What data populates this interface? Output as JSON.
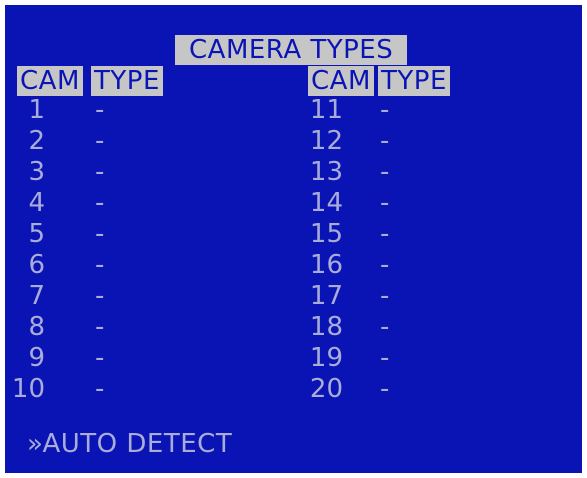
{
  "screen": {
    "title": "CAMERA TYPES",
    "headers": {
      "cam_left": "CAM",
      "type_left": "TYPE",
      "cam_right": "CAM",
      "type_right": "TYPE"
    },
    "left_rows": [
      {
        "cam": "1",
        "type": "-"
      },
      {
        "cam": "2",
        "type": "-"
      },
      {
        "cam": "3",
        "type": "-"
      },
      {
        "cam": "4",
        "type": "-"
      },
      {
        "cam": "5",
        "type": "-"
      },
      {
        "cam": "6",
        "type": "-"
      },
      {
        "cam": "7",
        "type": "-"
      },
      {
        "cam": "8",
        "type": "-"
      },
      {
        "cam": "9",
        "type": "-"
      },
      {
        "cam": "10",
        "type": "-"
      }
    ],
    "right_rows": [
      {
        "cam": "11",
        "type": "-"
      },
      {
        "cam": "12",
        "type": "-"
      },
      {
        "cam": "13",
        "type": "-"
      },
      {
        "cam": "14",
        "type": "-"
      },
      {
        "cam": "15",
        "type": "-"
      },
      {
        "cam": "16",
        "type": "-"
      },
      {
        "cam": "17",
        "type": "-"
      },
      {
        "cam": "18",
        "type": "-"
      },
      {
        "cam": "19",
        "type": "-"
      },
      {
        "cam": "20",
        "type": "-"
      }
    ],
    "auto_detect_label": "»AUTO DETECT"
  },
  "colors": {
    "background": "#0a14b4",
    "text": "#a9acd8",
    "highlight": "#c6c6c6"
  }
}
